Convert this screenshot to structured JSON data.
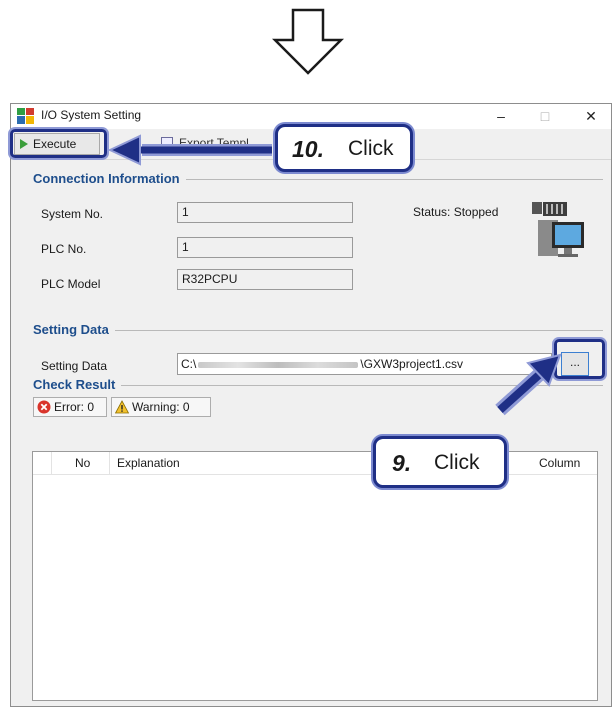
{
  "window": {
    "title": "I/O System Setting",
    "minimize": "–",
    "maximize": "□",
    "close": "✕"
  },
  "toolbar": {
    "execute_label": "Execute",
    "second_label": "Export Templ"
  },
  "connection": {
    "title": "Connection Information",
    "system_no_label": "System No.",
    "system_no_value": "1",
    "plc_no_label": "PLC No.",
    "plc_no_value": "1",
    "plc_model_label": "PLC Model",
    "plc_model_value": "R32PCPU",
    "status_text": "Status: Stopped"
  },
  "setting_data": {
    "title": "Setting Data",
    "label": "Setting Data",
    "path_prefix": "C:\\",
    "path_suffix": "\\GXW3project1.csv",
    "browse_label": "..."
  },
  "check_result": {
    "title": "Check Result",
    "error_label": "Error: 0",
    "warning_label": "Warning: 0",
    "columns": [
      "No",
      "Explanation",
      "Column"
    ]
  },
  "callouts": {
    "step10_num": "10.",
    "step10_text": "Click",
    "step9_num": "9.",
    "step9_text": "Click"
  },
  "colors": {
    "accent": "#1e4e8c",
    "callout_border": "#1f2f86",
    "play": "#3a9d3a"
  }
}
